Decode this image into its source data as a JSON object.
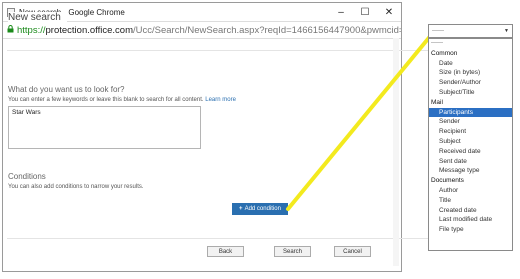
{
  "window": {
    "title": "New search - Google Chrome",
    "controls": {
      "minimize": "–",
      "maximize": "☐",
      "close": "✕"
    }
  },
  "address": {
    "scheme": "https://",
    "host": "protection.office.com",
    "path": "/Ucc/Search/NewSearch.aspx?reqId=1466156447900&pwmcid=3&Retur"
  },
  "page": {
    "title": "New search",
    "query_heading": "What do you want us to look for?",
    "query_help": "You can enter a few keywords or leave this blank to search for all content.",
    "query_help_link": "Learn more",
    "query_value": "Star Wars",
    "conditions_heading": "Conditions",
    "conditions_help": "You can also add conditions to narrow your results.",
    "add_condition_label": "Add condition",
    "buttons": {
      "back": "Back",
      "search": "Search",
      "cancel": "Cancel"
    }
  },
  "dropdown": {
    "selected_value": "------",
    "placeholder": "------",
    "groups": [
      {
        "label": "Common",
        "items": [
          "Date",
          "Size (in bytes)",
          "Sender/Author",
          "Subject/Title"
        ]
      },
      {
        "label": "Mail",
        "items": [
          "Participants",
          "Sender",
          "Recipient",
          "Subject",
          "Received date",
          "Sent date",
          "Message type"
        ]
      },
      {
        "label": "Documents",
        "items": [
          "Author",
          "Title",
          "Created date",
          "Last modified date",
          "File type"
        ]
      }
    ],
    "highlighted_item": "Participants"
  },
  "colors": {
    "accent": "#2a6fb0",
    "selected_item": "#2b6fc3",
    "connector": "#f3ea1e",
    "secure": "#1a8a1a"
  }
}
